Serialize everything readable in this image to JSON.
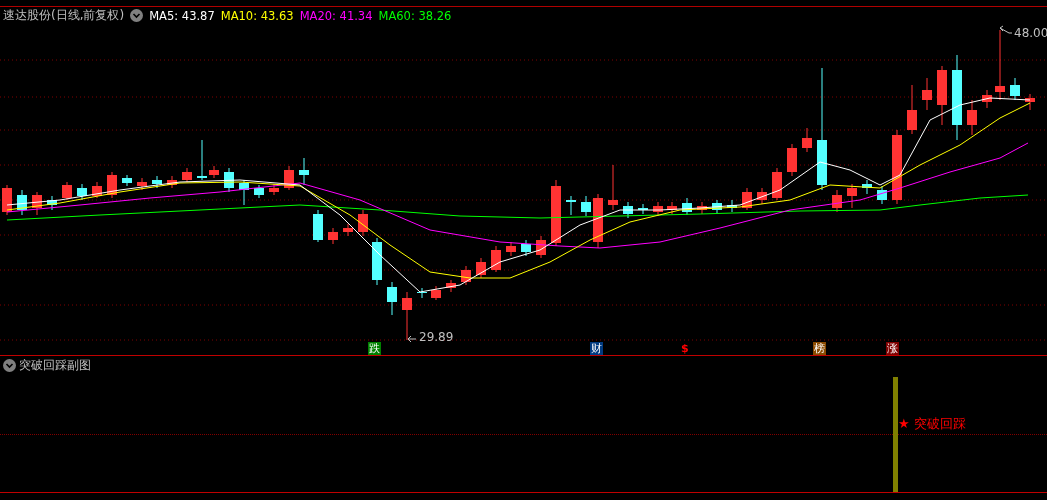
{
  "chart_header": {
    "title": "速达股份(日线,前复权)",
    "indicators": [
      {
        "text": "MA5: 43.87",
        "color": "#ffffff"
      },
      {
        "text": "MA10: 43.63",
        "color": "#ffff00"
      },
      {
        "text": "MA20: 41.34",
        "color": "#ff00ff"
      },
      {
        "text": "MA60: 38.26",
        "color": "#00ff00"
      }
    ]
  },
  "price_labels": [
    {
      "kind": "high",
      "text": "48.00"
    },
    {
      "kind": "low",
      "text": "29.89"
    }
  ],
  "event_markers": [
    {
      "kind": "badge",
      "text": "跌",
      "color": "#008000"
    },
    {
      "kind": "badge",
      "text": "财",
      "color": "#003a80"
    },
    {
      "kind": "plain",
      "text": "$",
      "color": "#ff0000"
    },
    {
      "kind": "badge",
      "text": "榜",
      "color": "#8a4a00"
    },
    {
      "kind": "badge",
      "text": "涨",
      "color": "#800000"
    }
  ],
  "sub_chart": {
    "title": "突破回踩副图",
    "signal_label": "★ 突破回踩"
  }
}
